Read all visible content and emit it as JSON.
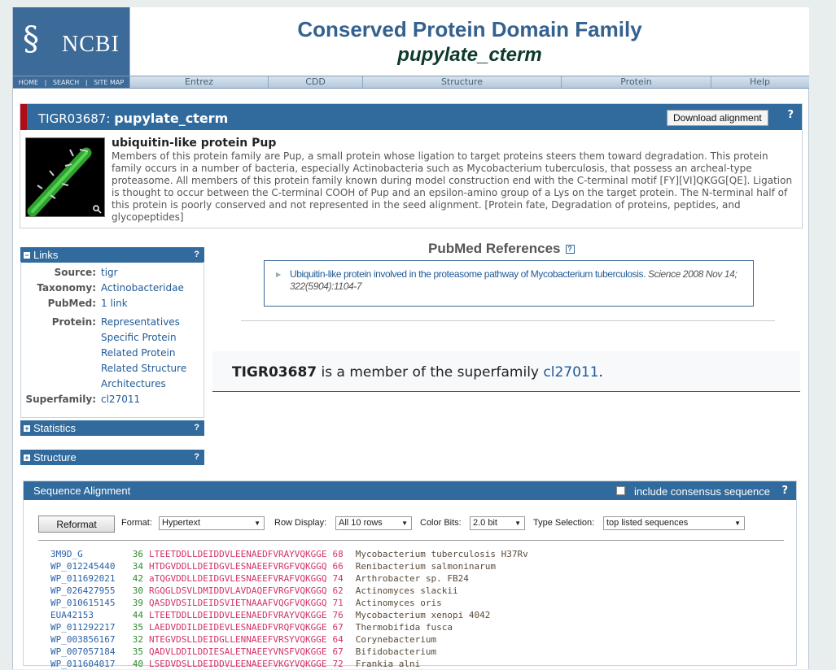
{
  "header": {
    "logo_text": "NCBI",
    "title": "Conserved Protein Domain Family",
    "family_name": "pupylate_cterm",
    "logo_links": [
      "HOME",
      "SEARCH",
      "SITE MAP"
    ],
    "nav": [
      "Entrez",
      "CDD",
      "Structure",
      "Protein",
      "Help"
    ]
  },
  "family": {
    "accession": "TIGR03687:",
    "short_name": "pupylate_cterm",
    "download_label": "Download alignment",
    "help": "?",
    "full_name": "ubiquitin-like protein Pup",
    "description": "Members of this protein family are Pup, a small protein whose ligation to target proteins steers them toward degradation. This protein family occurs in a number of bacteria, especially Actinobacteria such as Mycobacterium tuberculosis, that possess an archeal-type proteasome. All members of this protein family known during model construction end with the C-terminal motif [FY][VI]QKGG[QE]. Ligation is thought to occur between the C-terminal COOH of Pup and an epsilon-amino group of a Lys on the target protein. The N-terminal half of this protein is poorly conserved and not represented in the seed alignment. [Protein fate, Degradation of proteins, peptides, and glycopeptides]"
  },
  "links_panel": {
    "title": "Links",
    "help": "?",
    "source_label": "Source:",
    "source": "tigr",
    "taxonomy_label": "Taxonomy:",
    "taxonomy": "Actinobacteridae",
    "pubmed_label": "PubMed:",
    "pubmed": "1 link",
    "protein_label": "Protein:",
    "protein_links": [
      "Representatives",
      "Specific Protein",
      "Related Protein",
      "Related Structure",
      "Architectures"
    ],
    "superfamily_label": "Superfamily:",
    "superfamily": "cl27011"
  },
  "statistics_panel": {
    "title": "Statistics",
    "help": "?"
  },
  "structure_panel": {
    "title": "Structure",
    "help": "?"
  },
  "pubmed": {
    "title": "PubMed References",
    "help": "?",
    "ref_title": "Ubiquitin-like protein involved in the proteasome pathway of Mycobacterium tuberculosis.",
    "ref_cite": "Science 2008 Nov 14; 322(5904):1104-7"
  },
  "superfamily": {
    "accession": "TIGR03687",
    "text": "is a member of the superfamily",
    "link": "cl27011",
    "end": "."
  },
  "alignment": {
    "title": "Sequence Alignment",
    "consensus_label": "include consensus sequence",
    "help": "?",
    "reformat_label": "Reformat",
    "format_label": "Format:",
    "format_value": "Hypertext",
    "row_display_label": "Row Display:",
    "row_display_value": "All 10 rows",
    "color_bits_label": "Color Bits:",
    "color_bits_value": "2.0 bit",
    "type_selection_label": "Type Selection:",
    "type_selection_value": "top listed sequences",
    "rows": [
      {
        "id": "3M9D_G",
        "start": "36",
        "seq": "LTEETDDLLDEIDDVLEENAEDFVRAYVQKGGE",
        "end": "68",
        "org": "Mycobacterium tuberculosis H37Rv"
      },
      {
        "id": "WP_012245440",
        "start": "34",
        "seq": "HTDGVDDLLDEIDGVLESNAEEFVRGFVQKGGQ",
        "end": "66",
        "org": "Renibacterium salmoninarum"
      },
      {
        "id": "WP_011692021",
        "start": "42",
        "seq": "aTQGVDDLLDEIDGVLESNAEEFVRAFVQKGGQ",
        "end": "74",
        "org": "Arthrobacter sp. FB24"
      },
      {
        "id": "WP_026427955",
        "start": "30",
        "seq": "RGQGLDSVLDMIDDVLAVDAQEFVRGFVQKGGQ",
        "end": "62",
        "org": "Actinomyces slackii"
      },
      {
        "id": "WP_010615145",
        "start": "39",
        "seq": "QASDVDSILDEIDSVIETNAAAFVQGFVQKGGQ",
        "end": "71",
        "org": "Actinomyces oris"
      },
      {
        "id": "EUA42153",
        "start": "44",
        "seq": "LTEETDDLLDEIDDVLEENAEDFVRAYVQKGGE",
        "end": "76",
        "org": "Mycobacterium xenopi 4042"
      },
      {
        "id": "WP_011292217",
        "start": "35",
        "seq": "LAEDVDDILDEIDEVLESNAEDFVRQFVQKGGE",
        "end": "67",
        "org": "Thermobifida fusca"
      },
      {
        "id": "WP_003856167",
        "start": "32",
        "seq": "NTEGVDSLLDEIDGLLENNAEEFVRSYVQKGGE",
        "end": "64",
        "org": "Corynebacterium"
      },
      {
        "id": "WP_007057184",
        "start": "35",
        "seq": "QADVLDDILDDIESALETNAEEYVNSFVQKGGE",
        "end": "67",
        "org": "Bifidobacterium"
      },
      {
        "id": "WP_011604017",
        "start": "40",
        "seq": "LSEDVDSLLDEIDDVLEENAEEFVKGYVQKGGE",
        "end": "72",
        "org": "Frankia alni"
      }
    ]
  }
}
